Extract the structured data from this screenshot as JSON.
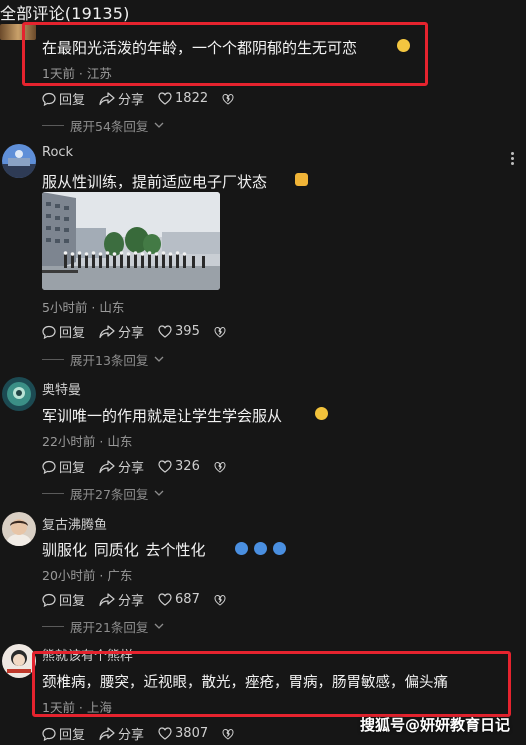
{
  "header": {
    "title": "全部评论(19135)"
  },
  "comments": [
    {
      "text": "在最阳光活泼的年龄，一个个都阴郁的生无可恋",
      "meta": "1天前 · 江苏",
      "reply_label": "回复",
      "share_label": "分享",
      "likes": "1822",
      "expand": "展开54条回复"
    },
    {
      "username": "Rock",
      "text": "服从性训练，提前适应电子厂状态",
      "meta": "5小时前 · 山东",
      "reply_label": "回复",
      "share_label": "分享",
      "likes": "395",
      "expand": "展开13条回复"
    },
    {
      "username": "奥特曼",
      "text": "军训唯一的作用就是让学生学会服从",
      "meta": "22小时前 · 山东",
      "reply_label": "回复",
      "share_label": "分享",
      "likes": "326",
      "expand": "展开27条回复"
    },
    {
      "username": "复古沸腾鱼",
      "text": "驯服化  同质化  去个性化",
      "meta": "20小时前 · 广东",
      "reply_label": "回复",
      "share_label": "分享",
      "likes": "687",
      "expand": "展开21条回复"
    },
    {
      "username": "熊就该有个熊样",
      "text": "颈椎病，腰突，近视眼，散光，痤疮，胃病，肠胃敏感，偏头痛",
      "meta": "1天前 · 上海",
      "reply_label": "回复",
      "share_label": "分享",
      "likes": "3807"
    }
  ],
  "watermark": "搜狐号@妍妍教育日记",
  "colors": {
    "background": "#161616",
    "highlight": "#e5232e",
    "muted": "#9a9a9a"
  },
  "icons": [
    "reply-icon",
    "share-icon",
    "heart-icon",
    "dislike-icon",
    "chevron-down-icon",
    "more-icon"
  ]
}
